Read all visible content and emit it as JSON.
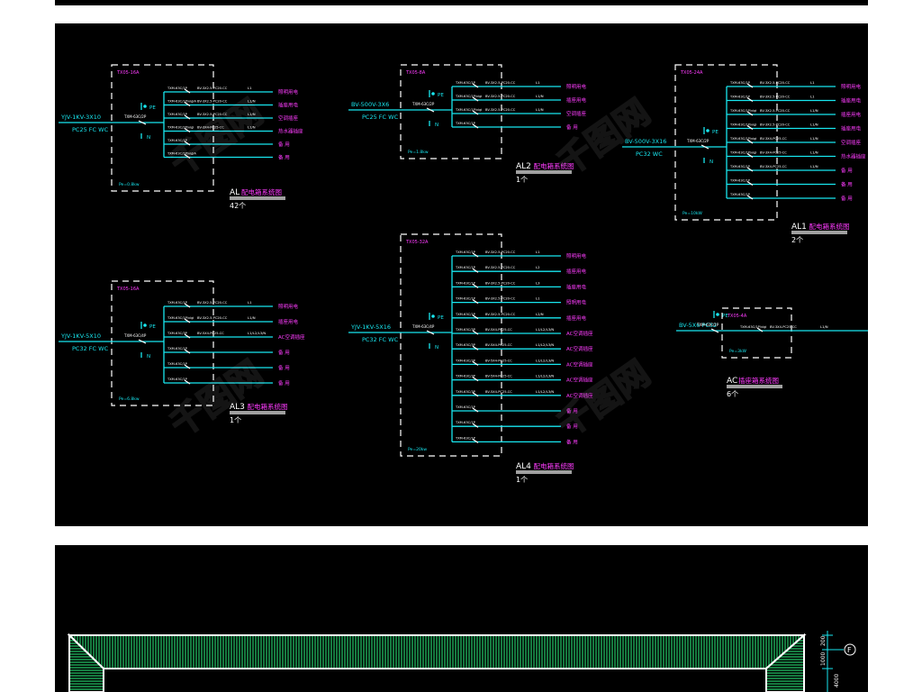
{
  "panels": {
    "AL": {
      "title_code": "AL",
      "title_text": "配电箱系统图",
      "count": "42个",
      "box_label": "TX05-16A",
      "pe_label": "PE",
      "n_label": "N",
      "pe_note": "Pe=0.8kw",
      "feeder_cable": "YJV-1KV-3X10",
      "feeder_conduit": "PC25 FC WC",
      "main_breaker": "TXM-63C/2P",
      "branch_breakers": [
        "TXM-63C/1P",
        "TXM-63C/1P/vigiA",
        "TXM-63C/1P",
        "TXM-63C/2P/vigi",
        "TXM-63C/1P",
        "TXM-63C/1P/vigiA"
      ],
      "branch_cables": [
        "BV-3X2.5-PC20-CC",
        "BV-3X2.5-PC20-CC",
        "BV-3X2.5-PC20-CC",
        "BV-3X4-PC25-CC",
        "",
        ""
      ],
      "branch_phases": [
        "L1",
        "L1/N",
        "L1/N",
        "L1/N",
        "",
        ""
      ],
      "branch_loads": [
        "照明用电",
        "插座用电",
        "空调插座",
        "热水器插座",
        "备 用",
        "备 用"
      ]
    },
    "AL1": {
      "title_code": "AL1",
      "title_text": "配电箱系统图",
      "count": "2个",
      "box_label": "TX05-24A",
      "pe_label": "PE",
      "n_label": "N",
      "pe_note": "Pe=10kW",
      "feeder_cable": "BV-500V-3X16",
      "feeder_conduit": "PC32 WC",
      "main_breaker": "TXM-63C/2P",
      "branch_breakers": [
        "TXM-63C/1P",
        "TXM-63C/1P",
        "TXM-63C/1P/vigi",
        "TXM-63C/1P/vigi",
        "TXM-63C/1P/vigi",
        "TXM-63C/1P/vigi",
        "TXM-63C/1P",
        "TXM-63C/1P",
        "TXM-63C/1P"
      ],
      "branch_cables": [
        "BV-3X2.5-PC20-CC",
        "BV-3X2.5-PC20-CC",
        "BV-3X2.5-PC20-CC",
        "BV-3X2.5-PC20-CC",
        "BV-3X4-PC25-CC",
        "BV-3X4-PC25-CC",
        "BV-3X4-PC25-CC",
        "",
        ""
      ],
      "branch_phases": [
        "L1",
        "L1",
        "L1/N",
        "L1/N",
        "L1/N",
        "L1/N",
        "L1/N",
        "",
        ""
      ],
      "branch_loads": [
        "照明用电",
        "插座用电",
        "插座用电",
        "插座用电",
        "空调插座",
        "热水器插座",
        "备 用",
        "备 用",
        "备 用"
      ]
    },
    "AL2": {
      "title_code": "AL2",
      "title_text": "配电箱系统图",
      "count": "1个",
      "box_label": "TX05-8A",
      "pe_label": "PE",
      "n_label": "N",
      "pe_note": "Pe=1.8kw",
      "feeder_cable": "BV-500V-3X6",
      "feeder_conduit": "PC25 FC WC",
      "main_breaker": "TXM-63C/2P",
      "branch_breakers": [
        "TXM-63C/1P",
        "TXM-63C/1P/vigi",
        "TXM-63C/1P/vigi",
        "TXM-63C/1P"
      ],
      "branch_cables": [
        "BV-3X2.5-PC20-CC",
        "BV-3X2.5-PC20-CC",
        "BV-3X2.5-PC20-CC",
        ""
      ],
      "branch_phases": [
        "L1",
        "L1/N",
        "L1/N",
        ""
      ],
      "branch_loads": [
        "照明用电",
        "插座用电",
        "空调插座",
        "备 用"
      ]
    },
    "AL3": {
      "title_code": "AL3",
      "title_text": "配电箱系统图",
      "count": "1个",
      "box_label": "TX05-16A",
      "pe_label": "PE",
      "n_label": "N",
      "pe_note": "Pe=6.8kw",
      "feeder_cable": "YJV-1KV-5X10",
      "feeder_conduit": "PC32 FC WC",
      "main_breaker": "TXM-63C/4P",
      "branch_breakers": [
        "TXM-63C/1P",
        "TXM-63C/1P/vigi",
        "TXM-63C/3P",
        "TXM-63C/1P",
        "TXM-63C/1P",
        "TXM-63C/1P"
      ],
      "branch_cables": [
        "BV-3X2.5-PC20-CC",
        "BV-3X2.5-PC20-CC",
        "BV-5X4-PC25-CC",
        "",
        "",
        ""
      ],
      "branch_phases": [
        "L1",
        "L1/N",
        "L1/L2/L3/N",
        "",
        "",
        ""
      ],
      "branch_loads": [
        "照明用电",
        "插座用电",
        "AC空调插座",
        "备 用",
        "备 用",
        "备 用"
      ]
    },
    "AL4": {
      "title_code": "AL4",
      "title_text": "配电箱系统图",
      "count": "1个",
      "box_label": "TX05-32A",
      "pe_label": "PE",
      "n_label": "N",
      "pe_note": "Pe=20kw",
      "feeder_cable": "YJV-1KV-5X16",
      "feeder_conduit": "PC32 FC WC",
      "main_breaker": "TXM-63C/4P",
      "branch_breakers": [
        "TXM-63C/1P",
        "TXM-63C/1P",
        "TXM-63C/1P",
        "TXM-63C/1P",
        "TXM-63C/1P",
        "TXM-63C/3P",
        "TXM-63C/3P",
        "TXM-63C/3P",
        "TXM-63C/3P",
        "TXM-63C/3P",
        "TXM-63C/1P",
        "TXM-63C/1P",
        "TXM-63C/1P"
      ],
      "branch_cables": [
        "BV-3X2.5-PC20-CC",
        "BV-3X2.5-PC20-CC",
        "BV-3X2.5-PC20-CC",
        "BV-3X2.5-PC20-CC",
        "BV-3X2.5-PC20-CC",
        "BV-5X4-PC25-CC",
        "BV-5X4-PC25-CC",
        "BV-5X4-PC25-CC",
        "BV-5X4-PC25-CC",
        "BV-5X4-PC25-CC",
        "",
        "",
        ""
      ],
      "branch_phases": [
        "L1",
        "L2",
        "L3",
        "L1",
        "L2/N",
        "L1/L2/L3/N",
        "L1/L2/L3/N",
        "L1/L2/L3/N",
        "L1/L2/L3/N",
        "L1/L2/L3/N",
        "",
        "",
        ""
      ],
      "branch_loads": [
        "照明用电",
        "插座用电",
        "插座用电",
        "照明用电",
        "插座用电",
        "AC空调插座",
        "AC空调插座",
        "AC空调插座",
        "AC空调插座",
        "AC空调插座",
        "备 用",
        "备 用",
        "备 用"
      ]
    },
    "AC": {
      "title_code": "AC",
      "title_text": "插座箱系统图",
      "count": "6个",
      "box_label": "TX05-4A",
      "pe_label": "PE",
      "n_label": "N",
      "pe_note": "Pe=3kW",
      "feeder_cable": "BV-5X6 PC32",
      "feeder_conduit": "",
      "main_breaker": "TXM-63C/1P",
      "branch_breakers": [
        "TXM-63C/1P/vigi"
      ],
      "branch_cables": [
        "BV-3X4-PC25-CC"
      ],
      "branch_phases": [
        "L1/N"
      ],
      "branch_loads": [
        "空调插座"
      ]
    }
  },
  "plan": {
    "axis_label": "F",
    "dims": [
      "200",
      "1000",
      "4000"
    ]
  },
  "watermark": "千图网",
  "colors": {
    "background": "#000000",
    "wire": "#18e6ef",
    "text_load": "#ff3cff",
    "frame": "#ffffff",
    "hatch": "#1fae5b"
  }
}
